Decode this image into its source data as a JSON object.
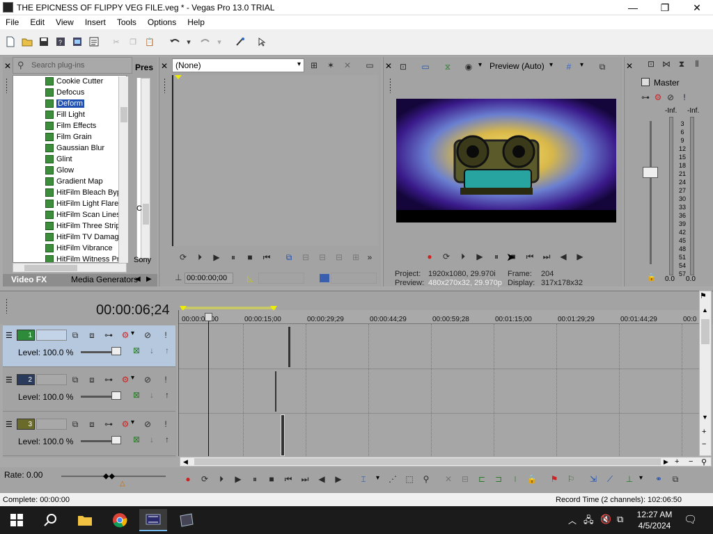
{
  "window": {
    "title": "THE EPICNESS OF FLIPPY VEG FILE.veg * - Vegas Pro 13.0 TRIAL",
    "minimize": "—",
    "maximize": "❐",
    "close": "✕"
  },
  "menu": [
    "File",
    "Edit",
    "View",
    "Insert",
    "Tools",
    "Options",
    "Help"
  ],
  "explorer": {
    "search_placeholder": "Search plug-ins",
    "presets_tab": "Pres",
    "plugins": [
      "Cookie Cutter",
      "Defocus",
      "Deform",
      "Fill Light",
      "Film Effects",
      "Film Grain",
      "Gaussian Blur",
      "Glint",
      "Glow",
      "Gradient Map",
      "HitFilm Bleach Byp",
      "HitFilm Light Flares",
      "HitFilm Scan Lines",
      "HitFilm Three Strip",
      "HitFilm TV Damage",
      "HitFilm Vibrance",
      "HitFilm Witness Pr"
    ],
    "selected_plugin": "Deform",
    "side_label_c": "C",
    "side_label_sony": "Sony",
    "tabs": {
      "video_fx": "Video FX",
      "media_generators": "Media Generators"
    }
  },
  "trimmer": {
    "selector_value": "(None)",
    "timecode": "00:00:00;00"
  },
  "preview": {
    "mode_label": "Preview (Auto)",
    "project_label": "Project:",
    "project_value": "1920x1080, 29.970i",
    "preview_label": "Preview:",
    "preview_value": "480x270x32, 29.970p",
    "frame_label": "Frame:",
    "frame_value": "204",
    "display_label": "Display:",
    "display_value": "317x178x32"
  },
  "master": {
    "title": "Master",
    "inf_left": "-Inf.",
    "inf_right": "-Inf.",
    "scale": [
      "3",
      "6",
      "9",
      "12",
      "15",
      "18",
      "21",
      "24",
      "27",
      "30",
      "33",
      "36",
      "39",
      "42",
      "45",
      "48",
      "51",
      "54",
      "57"
    ],
    "value_left": "0.0",
    "value_right": "0.0"
  },
  "timeline": {
    "timecode": "00:00:06;24",
    "ruler": [
      "00:00:00;00",
      "00:00:15;00",
      "00:00:29;29",
      "00:00:44;29",
      "00:00:59;28",
      "00:01:15;00",
      "00:01:29;29",
      "00:01:44;29",
      "00:0"
    ],
    "tracks": [
      {
        "number": "1",
        "level": "Level: 100.0 %"
      },
      {
        "number": "2",
        "level": "Level: 100.0 %"
      },
      {
        "number": "3",
        "level": "Level: 100.0 %"
      }
    ],
    "rate": "Rate: 0.00"
  },
  "status": {
    "complete": "Complete: 00:00:00",
    "record_time": "Record Time (2 channels): 102:06:50"
  },
  "taskbar": {
    "time": "12:27 AM",
    "date": "4/5/2024"
  },
  "colors": {
    "panel": "#a3a3a3",
    "active_track": "#b6c8de",
    "selection": "#1f4fb0",
    "taskbar": "#1b1b1b"
  }
}
